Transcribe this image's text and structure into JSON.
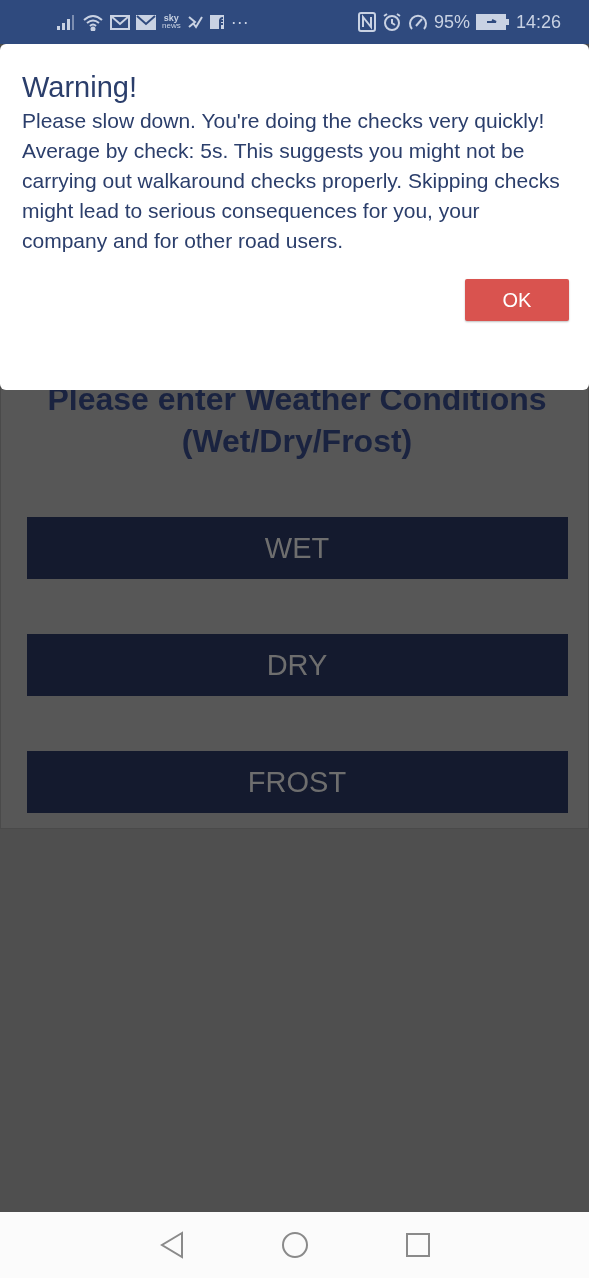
{
  "status_bar": {
    "sky_news_label": [
      "sky",
      "news"
    ],
    "more": "···",
    "battery": "95%",
    "time": "14:26"
  },
  "dialog": {
    "title": "Warning!",
    "message": "Please slow down. You're doing the checks very quickly! Average by check: 5s. This  suggests  you might not be carrying out walkaround checks properly. Skipping checks might lead to serious consequences for you, your company and for other road users.",
    "button": "OK"
  },
  "page": {
    "heading": "Please enter Weather Conditions (Wet/Dry/Frost)",
    "options": [
      "WET",
      "DRY",
      "FROST"
    ]
  }
}
